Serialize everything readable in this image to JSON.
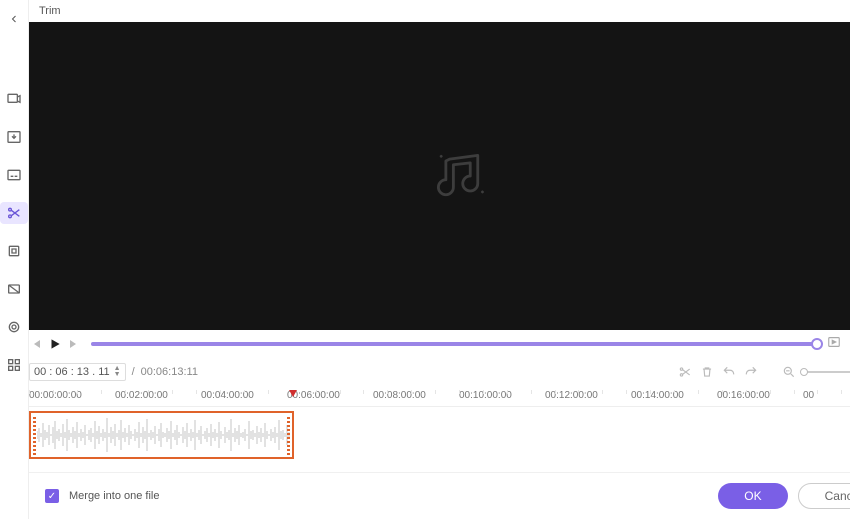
{
  "sidebar": {
    "items": [
      {
        "name": "record-icon"
      },
      {
        "name": "download-icon"
      },
      {
        "name": "subtitle-icon"
      },
      {
        "name": "trim-icon"
      },
      {
        "name": "crop-icon"
      },
      {
        "name": "ratio-icon"
      },
      {
        "name": "effects-icon"
      },
      {
        "name": "grid-icon"
      }
    ],
    "active_index": 3
  },
  "window": {
    "title": "Trim"
  },
  "playback": {
    "current_time_display": "00 : 06 : 13 . 11",
    "duration_display": "00:06:13:11"
  },
  "timeline": {
    "labels": [
      "00:00:00:00",
      "00:02:00:00",
      "00:04:00:00",
      "00:06:00:00",
      "00:08:00:00",
      "00:10:00:00",
      "00:12:00:00",
      "00:14:00:00",
      "00:16:00:00",
      "00"
    ],
    "playhead_label_index": 3
  },
  "selection": {
    "start": "00:00:00:00",
    "end": "00:06:13:11"
  },
  "footer": {
    "merge_label": "Merge into one file",
    "merge_checked": true,
    "ok_label": "OK",
    "cancel_label": "Cancel"
  },
  "colors": {
    "accent": "#7a5fe6",
    "selection_border": "#e0632a",
    "playhead": "#d02f2f"
  }
}
